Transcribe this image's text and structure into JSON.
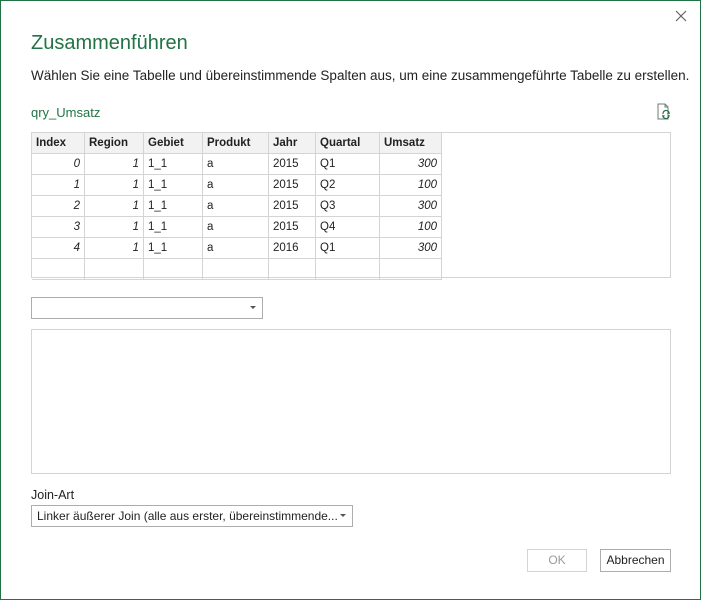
{
  "dialog": {
    "title": "Zusammenführen",
    "subtitle": "Wählen Sie eine Tabelle und übereinstimmende Spalten aus, um eine zusammengeführte Tabelle zu erstellen.",
    "query_name": "qry_Umsatz"
  },
  "preview": {
    "columns": [
      "Index",
      "Region",
      "Gebiet",
      "Produkt",
      "Jahr",
      "Quartal",
      "Umsatz"
    ],
    "rows": [
      [
        "0",
        "1",
        "1_1",
        "a",
        "2015",
        "Q1",
        "300"
      ],
      [
        "1",
        "1",
        "1_1",
        "a",
        "2015",
        "Q2",
        "100"
      ],
      [
        "2",
        "1",
        "1_1",
        "a",
        "2015",
        "Q3",
        "300"
      ],
      [
        "3",
        "1",
        "1_1",
        "a",
        "2015",
        "Q4",
        "100"
      ],
      [
        "4",
        "1",
        "1_1",
        "a",
        "2016",
        "Q1",
        "300"
      ]
    ]
  },
  "second_table_select": {
    "value": ""
  },
  "join": {
    "label": "Join-Art",
    "value": "Linker äußerer Join (alle aus erster, übereinstimmende..."
  },
  "buttons": {
    "ok": "OK",
    "cancel": "Abbrechen"
  },
  "colors": {
    "accent": "#217346"
  }
}
